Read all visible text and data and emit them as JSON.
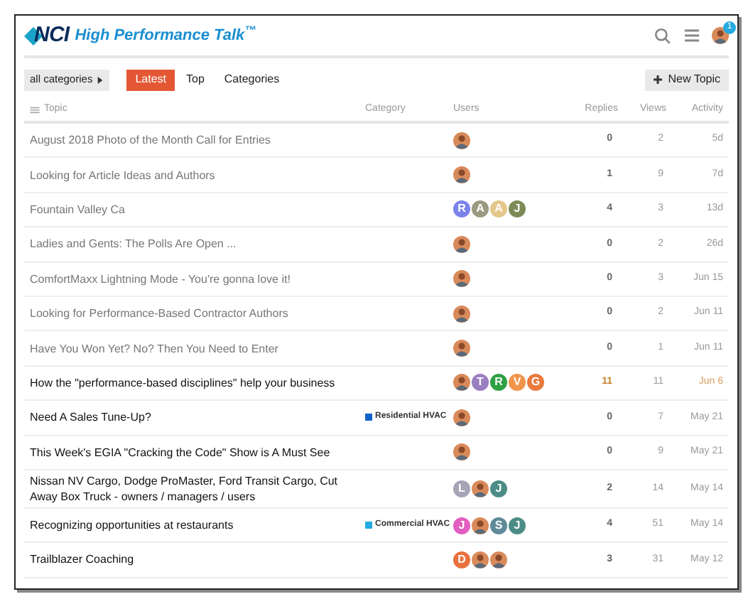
{
  "header": {
    "logo": "NCI",
    "site_title": "High Performance Talk$^{™}$",
    "notification_count": "1"
  },
  "nav": {
    "category_filter": "all categories",
    "tabs": [
      {
        "label": "Latest",
        "selected": true
      },
      {
        "label": "Top",
        "selected": false
      },
      {
        "label": "Categories",
        "selected": false
      }
    ],
    "new_topic": "New Topic"
  },
  "table": {
    "columns": [
      "Topic",
      "Category",
      "Users",
      "Replies",
      "Views",
      "Activity"
    ],
    "rows": [
      {
        "title": "August 2018 Photo of the Month Call for Entries",
        "read": true,
        "hot": false,
        "users": [
          {
            "kind": "photo"
          }
        ],
        "replies": "0",
        "views": "2",
        "activity": "5d"
      },
      {
        "title": "Looking for Article Ideas and Authors",
        "read": true,
        "hot": false,
        "users": [
          {
            "kind": "photo"
          }
        ],
        "replies": "1",
        "views": "9",
        "activity": "7d"
      },
      {
        "title": "Fountain Valley Ca",
        "read": true,
        "hot": false,
        "users": [
          {
            "kind": "letter",
            "letter": "R",
            "color": "#7b83eb"
          },
          {
            "kind": "letter",
            "letter": "A",
            "color": "#9a9a80"
          },
          {
            "kind": "letter",
            "letter": "A",
            "color": "#e4c78a"
          },
          {
            "kind": "letter",
            "letter": "J",
            "color": "#7d8a55"
          }
        ],
        "replies": "4",
        "views": "3",
        "activity": "13d"
      },
      {
        "title": "Ladies and Gents: The Polls Are Open ...",
        "read": true,
        "hot": false,
        "users": [
          {
            "kind": "photo"
          }
        ],
        "replies": "0",
        "views": "2",
        "activity": "26d"
      },
      {
        "title": "ComfortMaxx Lightning Mode - You're gonna love it!",
        "read": true,
        "hot": false,
        "users": [
          {
            "kind": "photo"
          }
        ],
        "replies": "0",
        "views": "3",
        "activity": "Jun 15"
      },
      {
        "title": "Looking for Performance-Based Contractor Authors",
        "read": true,
        "hot": false,
        "users": [
          {
            "kind": "photo"
          }
        ],
        "replies": "0",
        "views": "2",
        "activity": "Jun 11"
      },
      {
        "title": "Have You Won Yet? No? Then You Need to Enter",
        "read": true,
        "hot": false,
        "users": [
          {
            "kind": "photo"
          }
        ],
        "replies": "0",
        "views": "1",
        "activity": "Jun 11"
      },
      {
        "title": "How the \"performance-based disciplines\" help your business",
        "read": false,
        "hot": true,
        "users": [
          {
            "kind": "photo"
          },
          {
            "kind": "letter",
            "letter": "T",
            "color": "#9b7fc0"
          },
          {
            "kind": "letter",
            "letter": "R",
            "color": "#2ea043"
          },
          {
            "kind": "letter",
            "letter": "V",
            "color": "#f0944a"
          },
          {
            "kind": "letter",
            "letter": "G",
            "color": "#e97a3c"
          }
        ],
        "replies": "11",
        "views": "11",
        "activity": "Jun 6"
      },
      {
        "title": "Need A Sales Tune-Up?",
        "read": false,
        "hot": false,
        "category": {
          "name": "Residential HVAC",
          "color": "#0f62c8"
        },
        "users": [
          {
            "kind": "photo"
          }
        ],
        "replies": "0",
        "views": "7",
        "activity": "May 21"
      },
      {
        "title": "This Week's EGIA \"Cracking the Code\" Show is A Must See",
        "read": false,
        "hot": false,
        "users": [
          {
            "kind": "photo"
          }
        ],
        "replies": "0",
        "views": "9",
        "activity": "May 21"
      },
      {
        "title": "Nissan NV Cargo, Dodge ProMaster, Ford Transit Cargo, Cut Away Box Truck - owners / managers / users",
        "read": false,
        "hot": false,
        "users": [
          {
            "kind": "letter",
            "letter": "L",
            "color": "#a5a5b5"
          },
          {
            "kind": "photo"
          },
          {
            "kind": "letter",
            "letter": "J",
            "color": "#4d8c86"
          }
        ],
        "replies": "2",
        "views": "14",
        "activity": "May 14"
      },
      {
        "title": "Recognizing opportunities at restaurants",
        "read": false,
        "hot": false,
        "category": {
          "name": "Commercial HVAC",
          "color": "#25aae1"
        },
        "users": [
          {
            "kind": "letter",
            "letter": "J",
            "color": "#e25ec0"
          },
          {
            "kind": "photo"
          },
          {
            "kind": "letter",
            "letter": "S",
            "color": "#5f8a99"
          },
          {
            "kind": "letter",
            "letter": "J",
            "color": "#4d8c86"
          }
        ],
        "replies": "4",
        "views": "51",
        "activity": "May 14"
      },
      {
        "title": "Trailblazer Coaching",
        "read": false,
        "hot": false,
        "users": [
          {
            "kind": "letter",
            "letter": "D",
            "color": "#e9713f"
          },
          {
            "kind": "photo"
          },
          {
            "kind": "photo"
          }
        ],
        "replies": "3",
        "views": "31",
        "activity": "May 12"
      }
    ]
  }
}
